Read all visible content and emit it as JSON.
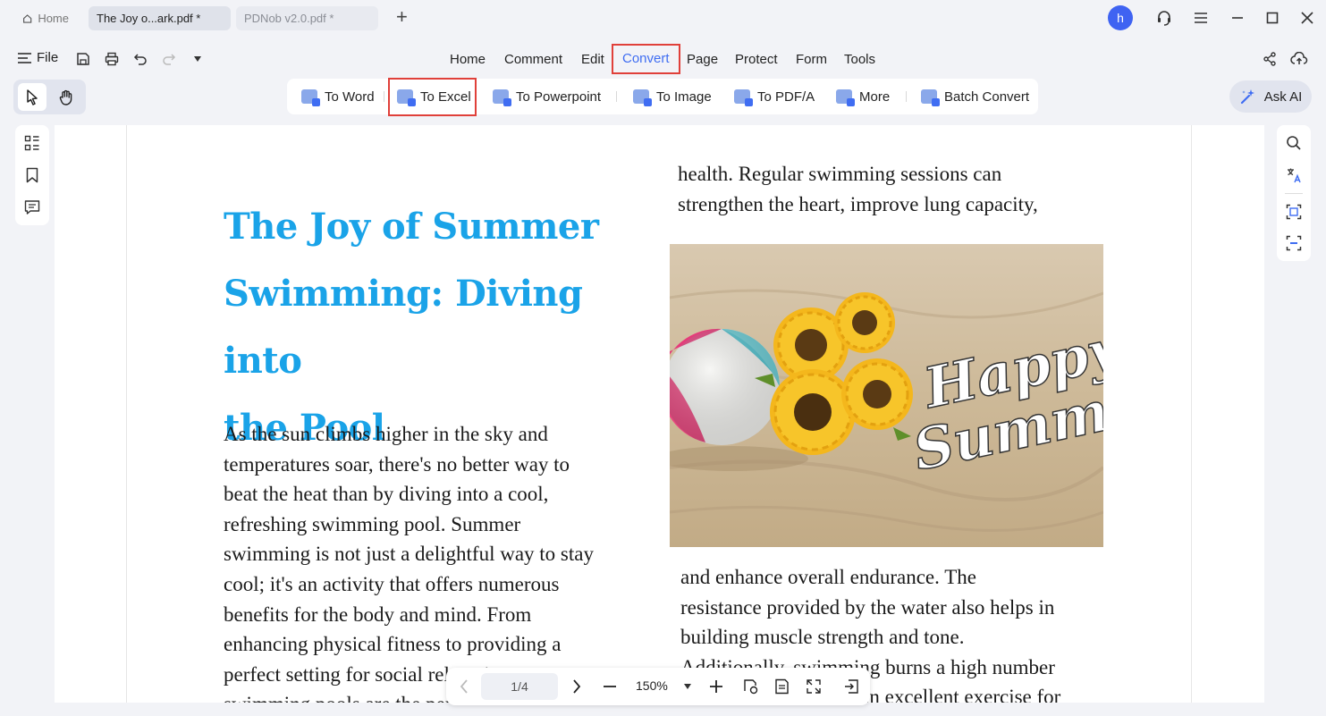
{
  "tabs": {
    "home_label": "Home",
    "active_label": "The Joy o...ark.pdf *",
    "inactive_label": "PDNob v2.0.pdf *",
    "new_tab": "+"
  },
  "account": {
    "avatar_letter": "h"
  },
  "menubar": {
    "file_label": "File",
    "items": [
      "Home",
      "Comment",
      "Edit",
      "Convert",
      "Page",
      "Protect",
      "Form",
      "Tools"
    ],
    "selected": "Convert"
  },
  "convert_toolbar": {
    "items": [
      "To Word",
      "To Excel",
      "To Powerpoint",
      "To Image",
      "To PDF/A",
      "More",
      "Batch Convert"
    ],
    "highlighted": "To Excel"
  },
  "ask_ai_label": "Ask AI",
  "document": {
    "title": "The Joy of Summer Swimming: Diving into the Pool",
    "title_lines": [
      "The Joy of Summer",
      "Swimming: Diving into",
      "the Pool"
    ],
    "left_lines": [
      "As the sun climbs higher in the sky and",
      "temperatures soar, there's no better way to",
      "beat the heat than by diving into a cool,",
      "refreshing swimming pool. Summer",
      "swimming is not just a delightful way to stay",
      "cool; it's an activity that offers numerous",
      "benefits for the body and mind. From",
      "enhancing physical fitness to providing a",
      "perfect setting for social relaxation,",
      "swimming pools are the perfect"
    ],
    "right_top_lines": [
      "health. Regular swimming sessions can",
      "strengthen the heart, improve lung capacity,"
    ],
    "right_bottom_lines": [
      "and enhance overall endurance. The",
      "resistance provided by the water also helps in",
      "building muscle strength and tone.",
      "Additionally, swimming burns a high number",
      "of calories, making it an excellent exercise for"
    ],
    "image_text_line1": "Happy",
    "image_text_line2": "Summer"
  },
  "pagebar": {
    "page_indicator": "1/4",
    "zoom": "150%"
  },
  "colors": {
    "accent": "#3f6df2",
    "title_blue": "#1aa3e8",
    "highlight_red": "#e0403a"
  }
}
